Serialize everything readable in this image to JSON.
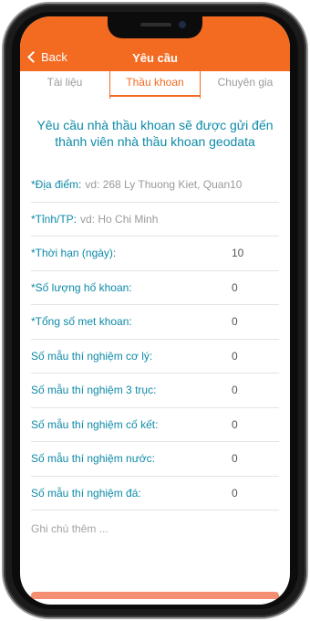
{
  "header": {
    "back_label": "Back",
    "title": "Yêu cầu"
  },
  "tabs": [
    {
      "label": "Tài liệu",
      "active": false
    },
    {
      "label": "Thầu khoan",
      "active": true
    },
    {
      "label": "Chuyên gia",
      "active": false
    }
  ],
  "notice": "Yêu cầu nhà thầu khoan sẽ được gửi đến thành viên nhà thầu khoan geodata",
  "fields": [
    {
      "label": "*Địa điểm:",
      "placeholder": "vd: 268 Ly Thuong Kiet, Quan10",
      "value": ""
    },
    {
      "label": "*Tỉnh/TP:",
      "placeholder": "vd: Ho Chi Minh",
      "value": ""
    },
    {
      "label": "*Thời hạn (ngày):",
      "placeholder": "",
      "value": "10"
    },
    {
      "label": "*Số lượng hố khoan:",
      "placeholder": "",
      "value": "0"
    },
    {
      "label": "*Tổng số met khoan:",
      "placeholder": "",
      "value": "0"
    },
    {
      "label": "Số mẫu thí nghiệm cơ lý:",
      "placeholder": "",
      "value": "0"
    },
    {
      "label": "Số mẫu thí nghiệm 3 trục:",
      "placeholder": "",
      "value": "0"
    },
    {
      "label": "Số mẫu thí nghiệm cố kết:",
      "placeholder": "",
      "value": "0"
    },
    {
      "label": "Số mẫu thí nghiệm nước:",
      "placeholder": "",
      "value": "0"
    },
    {
      "label": "Số mẫu thí nghiệm đá:",
      "placeholder": "",
      "value": "0"
    }
  ],
  "notes_placeholder": "Ghi chú thêm ...",
  "colors": {
    "accent": "#f36b21",
    "label": "#0d8aa8",
    "placeholder": "#9a9a9a"
  }
}
